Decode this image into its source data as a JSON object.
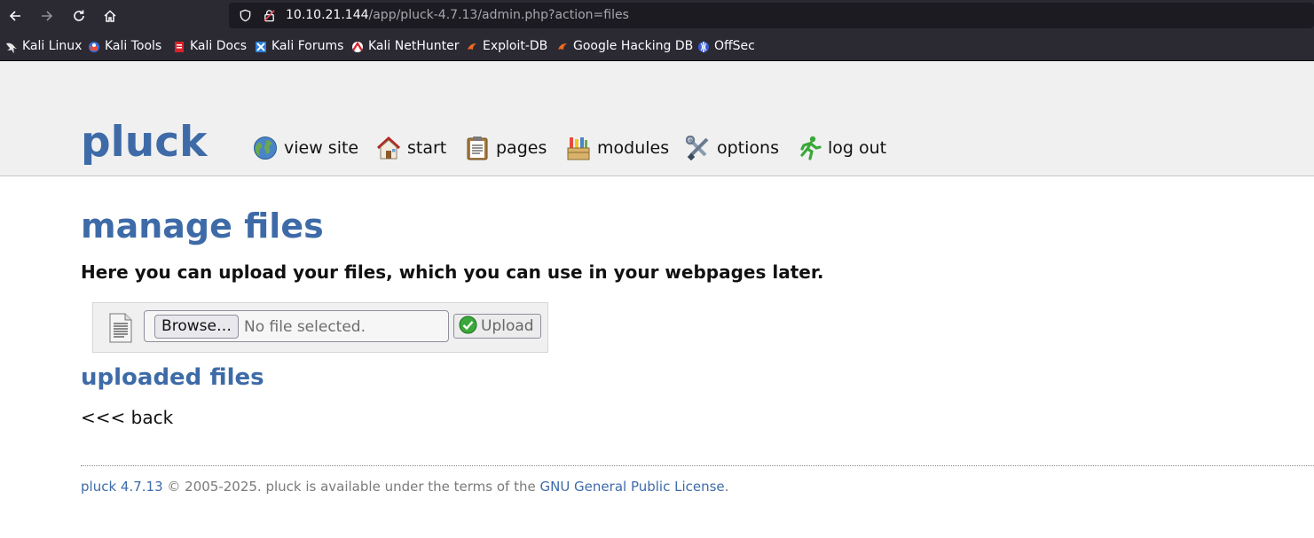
{
  "browser": {
    "url_host": "10.10.21.144",
    "url_path": "/app/pluck-4.7.13/admin.php?action=files",
    "bookmarks": [
      {
        "label": "Kali Linux",
        "icon": "kali-dragon-icon"
      },
      {
        "label": "Kali Tools",
        "icon": "kali-tools-icon"
      },
      {
        "label": "Kali Docs",
        "icon": "kali-docs-icon"
      },
      {
        "label": "Kali Forums",
        "icon": "kali-forums-icon"
      },
      {
        "label": "Kali NetHunter",
        "icon": "nethunter-icon"
      },
      {
        "label": "Exploit-DB",
        "icon": "exploit-db-icon"
      },
      {
        "label": "Google Hacking DB",
        "icon": "ghdb-icon"
      },
      {
        "label": "OffSec",
        "icon": "offsec-icon"
      }
    ]
  },
  "header": {
    "logo": "pluck",
    "menu": [
      {
        "label": "view site",
        "icon": "globe-icon"
      },
      {
        "label": "start",
        "icon": "house-icon"
      },
      {
        "label": "pages",
        "icon": "clipboard-icon"
      },
      {
        "label": "modules",
        "icon": "modules-box-icon"
      },
      {
        "label": "options",
        "icon": "tools-icon"
      },
      {
        "label": "log out",
        "icon": "running-man-icon"
      }
    ]
  },
  "main": {
    "title": "manage files",
    "intro": "Here you can upload your files, which you can use in your webpages later.",
    "upload": {
      "browse_label": "Browse…",
      "file_status": "No file selected.",
      "upload_label": "Upload"
    },
    "uploaded_title": "uploaded files",
    "back_link": "<<< back"
  },
  "footer": {
    "version_link": "pluck 4.7.13",
    "text": " © 2005-2025. pluck is available under the terms of the ",
    "license_link": "GNU General Public License",
    "end": "."
  },
  "colors": {
    "brand": "#3e6ba8",
    "chrome": "#2b2a33",
    "header_bg": "#f0f0f0"
  }
}
